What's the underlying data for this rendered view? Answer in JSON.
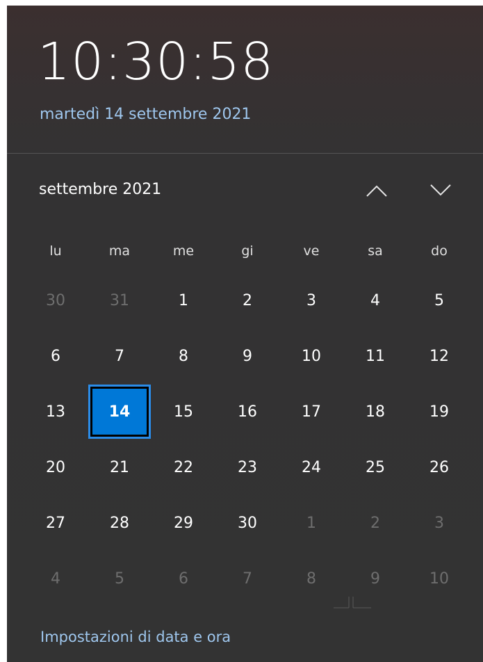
{
  "clock": {
    "time": "10:30:58",
    "date": "martedì 14 settembre 2021"
  },
  "calendar": {
    "month_label": "settembre 2021",
    "weekdays": [
      "lu",
      "ma",
      "me",
      "gi",
      "ve",
      "sa",
      "do"
    ],
    "weeks": [
      [
        {
          "d": "30",
          "muted": true
        },
        {
          "d": "31",
          "muted": true
        },
        {
          "d": "1"
        },
        {
          "d": "2"
        },
        {
          "d": "3"
        },
        {
          "d": "4"
        },
        {
          "d": "5"
        }
      ],
      [
        {
          "d": "6"
        },
        {
          "d": "7"
        },
        {
          "d": "8"
        },
        {
          "d": "9"
        },
        {
          "d": "10"
        },
        {
          "d": "11"
        },
        {
          "d": "12"
        }
      ],
      [
        {
          "d": "13"
        },
        {
          "d": "14",
          "today": true
        },
        {
          "d": "15"
        },
        {
          "d": "16"
        },
        {
          "d": "17"
        },
        {
          "d": "18"
        },
        {
          "d": "19"
        }
      ],
      [
        {
          "d": "20"
        },
        {
          "d": "21"
        },
        {
          "d": "22"
        },
        {
          "d": "23"
        },
        {
          "d": "24"
        },
        {
          "d": "25"
        },
        {
          "d": "26"
        }
      ],
      [
        {
          "d": "27"
        },
        {
          "d": "28"
        },
        {
          "d": "29"
        },
        {
          "d": "30"
        },
        {
          "d": "1",
          "muted": true
        },
        {
          "d": "2",
          "muted": true
        },
        {
          "d": "3",
          "muted": true
        }
      ],
      [
        {
          "d": "4",
          "muted": true
        },
        {
          "d": "5",
          "muted": true
        },
        {
          "d": "6",
          "muted": true
        },
        {
          "d": "7",
          "muted": true
        },
        {
          "d": "8",
          "muted": true
        },
        {
          "d": "9",
          "muted": true
        },
        {
          "d": "10",
          "muted": true
        }
      ]
    ]
  },
  "footer": {
    "settings_link": "Impostazioni di data e ora"
  },
  "icons": {
    "prev": "chevron-up-icon",
    "next": "chevron-down-icon"
  },
  "colors": {
    "accent": "#0078d7",
    "link": "#9fc7ee",
    "background": "#333333"
  }
}
